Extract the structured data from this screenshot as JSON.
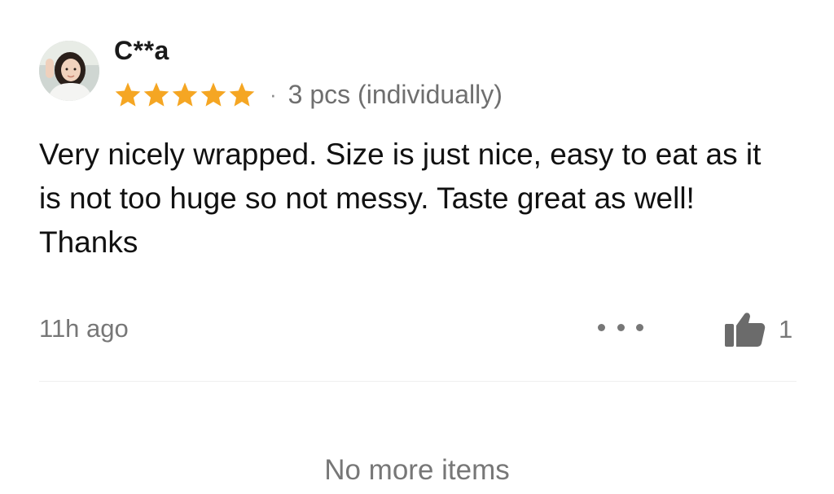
{
  "review": {
    "reviewer_name": "C**a",
    "avatar_icon": "user-avatar-photo",
    "rating": 5,
    "rating_max": 5,
    "star_color": "#F5A623",
    "separator": "·",
    "variant": "3 pcs (individually)",
    "text": "Very nicely wrapped. Size is just nice, easy to eat as it is not too huge so not messy. Taste great as well! Thanks",
    "time": "11h ago",
    "more_icon": "more-dots-icon",
    "like_icon": "thumbs-up-icon",
    "like_count": "1"
  },
  "list_footer": {
    "no_more_label": "No more items"
  }
}
